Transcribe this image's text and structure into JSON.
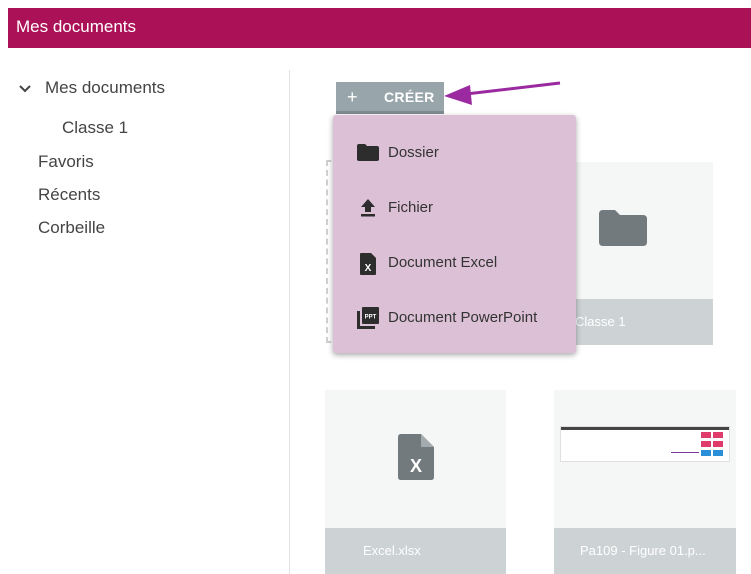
{
  "header": {
    "title": "Mes documents"
  },
  "sidebar": {
    "items": [
      {
        "label": "Mes documents"
      },
      {
        "label": "Classe 1"
      },
      {
        "label": "Favoris"
      },
      {
        "label": "Récents"
      },
      {
        "label": "Corbeille"
      }
    ]
  },
  "toolbar": {
    "create_label": "CRÉER",
    "create_icon": "plus-icon"
  },
  "menu": {
    "items": [
      {
        "label": "Dossier",
        "icon": "folder-icon"
      },
      {
        "label": "Fichier",
        "icon": "upload-icon"
      },
      {
        "label": "Document Excel",
        "icon": "excel-file-icon"
      },
      {
        "label": "Document PowerPoint",
        "icon": "powerpoint-icon"
      }
    ]
  },
  "files": [
    {
      "name": "Classe 1",
      "icon": "folder-icon"
    },
    {
      "name": "Excel.xlsx",
      "icon": "excel-file-icon"
    },
    {
      "name": "Pa109 - Figure 01.p...",
      "icon": "image-thumbnail"
    }
  ],
  "colors": {
    "header_bg": "#ab1157",
    "accent": "#9b2aa0",
    "menu_bg": "#dcc0d6",
    "button_bg": "#98a6ab"
  }
}
